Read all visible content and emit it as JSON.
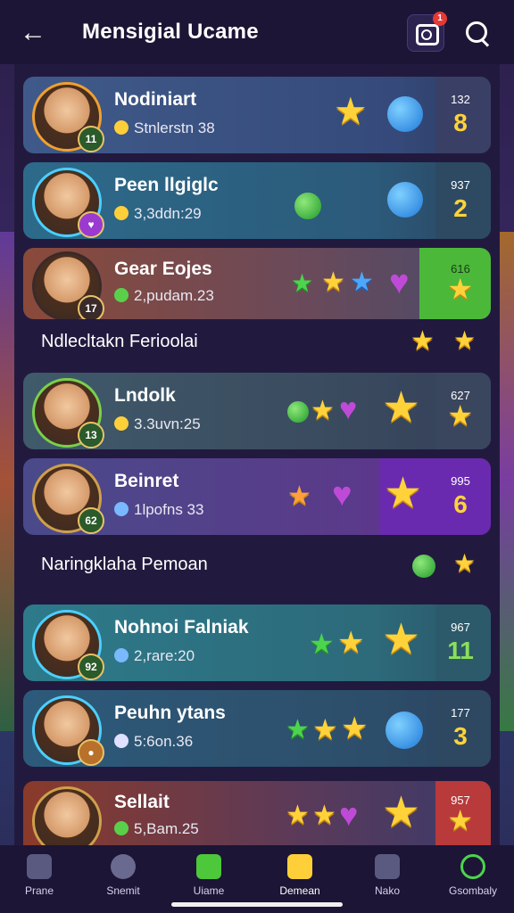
{
  "header": {
    "title": "Mensigial Ucame",
    "notif_count": "1"
  },
  "cards": [
    {
      "name": "Nodiniart",
      "sub": "Stnlerstn 38",
      "lvl": "11",
      "score": "132",
      "rank": "8"
    },
    {
      "name": "Peen llgiglc",
      "sub": "3,3ddn:29",
      "lvl": "",
      "score": "937",
      "rank": "2"
    },
    {
      "name": "Gear Eojes",
      "sub": "2,pudam.23",
      "lvl": "",
      "score": "616",
      "rank": ""
    },
    {
      "name": "Lndolk",
      "sub": "3.3uvn:25",
      "lvl": "13",
      "score": "627",
      "rank": ""
    },
    {
      "name": "Beinret",
      "sub": "1lpofns 33",
      "lvl": "62",
      "score": "995",
      "rank": "6"
    },
    {
      "name": "Nohnoi Falniak",
      "sub": "2,rare:20",
      "lvl": "92",
      "score": "967",
      "rank": "11"
    },
    {
      "name": "Peuhn ytans",
      "sub": "5:6on.36",
      "lvl": "",
      "score": "177",
      "rank": "3"
    },
    {
      "name": "Sellait",
      "sub": "5,Bam.25",
      "lvl": "",
      "score": "957",
      "rank": ""
    }
  ],
  "sections": [
    {
      "label": "Ndlecltakn Ferioolai"
    },
    {
      "label": "Naringklaha Pemoan"
    }
  ],
  "tabs": [
    {
      "label": "Prane"
    },
    {
      "label": "Snemit"
    },
    {
      "label": "Uiame"
    },
    {
      "label": "Demean"
    },
    {
      "label": "Nako"
    },
    {
      "label": "Gsombaly"
    }
  ],
  "colors": {
    "accent": "#ffd23a",
    "bg": "#221a3e",
    "header": "#1c1535"
  }
}
